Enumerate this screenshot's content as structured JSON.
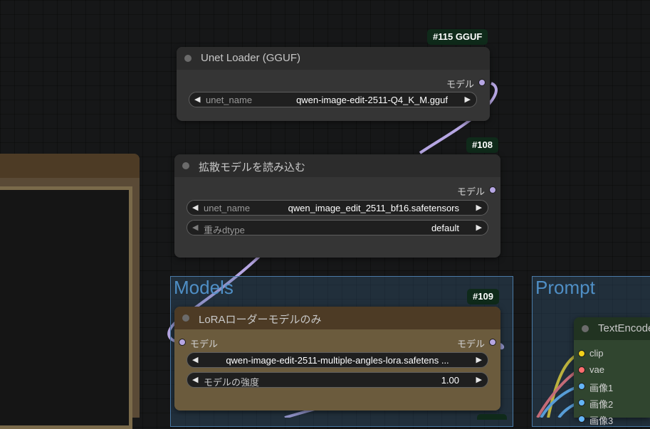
{
  "colors": {
    "canvas": "#161718",
    "link_model": "#b6a6e3",
    "link_clip": "#f2d21b",
    "link_vae": "#ff6e6e",
    "link_image": "#64b5f6",
    "group": "#4a7aa6",
    "lora_node": "#6b5b3d"
  },
  "groups": {
    "models": {
      "title": "Models"
    },
    "prompt": {
      "title": "Prompt"
    }
  },
  "nodes": {
    "unet_gguf": {
      "id_badge": "#115 GGUF",
      "title": "Unet Loader (GGUF)",
      "output_label": "モデル",
      "widget": {
        "name": "unet_name",
        "value": "qwen-image-edit-2511-Q4_K_M.gguf"
      }
    },
    "diffusion_loader": {
      "id_badge": "#108",
      "title": "拡散モデルを読み込む",
      "output_label": "モデル",
      "widgets": [
        {
          "name": "unet_name",
          "value": "qwen_image_edit_2511_bf16.safetensors"
        },
        {
          "name": "重みdtype",
          "value": "default"
        }
      ]
    },
    "lora_loader": {
      "id_badge": "#109",
      "title": "LoRAローダーモデルのみ",
      "input_label": "モデル",
      "output_label": "モデル",
      "widgets": [
        {
          "value": "qwen-image-edit-2511-multiple-angles-lora.safetens ..."
        },
        {
          "name": "モデルの強度",
          "value": "1.00"
        }
      ]
    },
    "text_encode": {
      "title": "TextEncode",
      "inputs": [
        {
          "label": "clip",
          "color": "#f2d21b"
        },
        {
          "label": "vae",
          "color": "#ff6e6e"
        },
        {
          "label": "画像1",
          "color": "#64b5f6"
        },
        {
          "label": "画像2",
          "color": "#64b5f6"
        },
        {
          "label": "画像3",
          "color": "#64b5f6"
        }
      ]
    }
  },
  "icons": {
    "status_dot": "circle-icon",
    "arrow_left": "triangle-left-icon",
    "arrow_right": "triangle-right-icon"
  }
}
